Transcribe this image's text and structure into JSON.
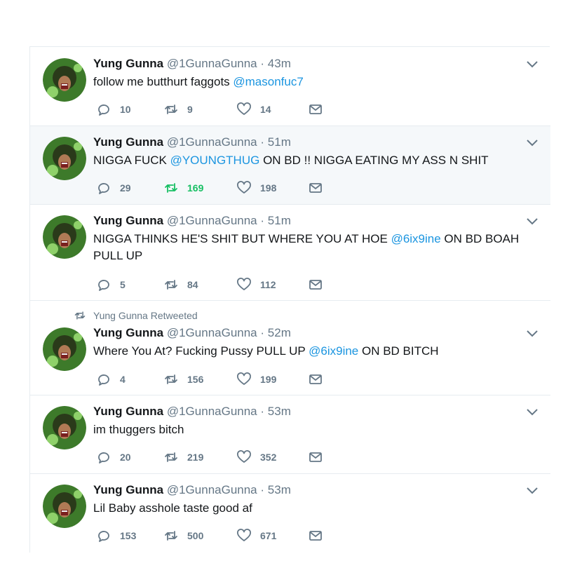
{
  "colors": {
    "mention": "#1b95e0",
    "meta": "#657786",
    "retweet_active": "#17bf63",
    "highlight_bg": "#f5f8fa"
  },
  "tweets": [
    {
      "name": "Yung Gunna",
      "handle": "@1GunnaGunna",
      "sep": "·",
      "time": "43m",
      "text_before": "follow me butthurt faggots ",
      "mention": "@masonfuc7",
      "text_after": "",
      "replies": "10",
      "retweets": "9",
      "likes": "14"
    },
    {
      "name": "Yung Gunna",
      "handle": "@1GunnaGunna",
      "sep": "·",
      "time": "51m",
      "text_before": "NIGGA FUCK ",
      "mention": "@YOUNGTHUG",
      "text_after": " ON BD !! NIGGA EATING MY ASS N SHIT",
      "replies": "29",
      "retweets": "169",
      "likes": "198"
    },
    {
      "name": "Yung Gunna",
      "handle": "@1GunnaGunna",
      "sep": "·",
      "time": "51m",
      "text_before": "NIGGA THINKS HE'S SHIT BUT WHERE YOU AT HOE ",
      "mention": "@6ix9ine",
      "text_after": " ON BD BOAH PULL UP",
      "replies": "5",
      "retweets": "84",
      "likes": "112"
    },
    {
      "retweeted_by": "Yung Gunna Retweeted",
      "name": "Yung Gunna",
      "handle": "@1GunnaGunna",
      "sep": "·",
      "time": "52m",
      "text_before": "Where You At? Fucking Pussy PULL UP ",
      "mention": "@6ix9ine",
      "text_after": " ON BD BITCH",
      "replies": "4",
      "retweets": "156",
      "likes": "199"
    },
    {
      "name": "Yung Gunna",
      "handle": "@1GunnaGunna",
      "sep": "·",
      "time": "53m",
      "text_before": "im thuggers bitch",
      "mention": "",
      "text_after": "",
      "replies": "20",
      "retweets": "219",
      "likes": "352"
    },
    {
      "name": "Yung Gunna",
      "handle": "@1GunnaGunna",
      "sep": "·",
      "time": "53m",
      "text_before": "Lil Baby asshole taste good af",
      "mention": "",
      "text_after": "",
      "replies": "153",
      "retweets": "500",
      "likes": "671"
    }
  ],
  "icons": {
    "reply": "reply-icon",
    "retweet": "retweet-icon",
    "like": "heart-icon",
    "dm": "envelope-icon",
    "caret": "chevron-down-icon",
    "avatar": "avatar"
  }
}
